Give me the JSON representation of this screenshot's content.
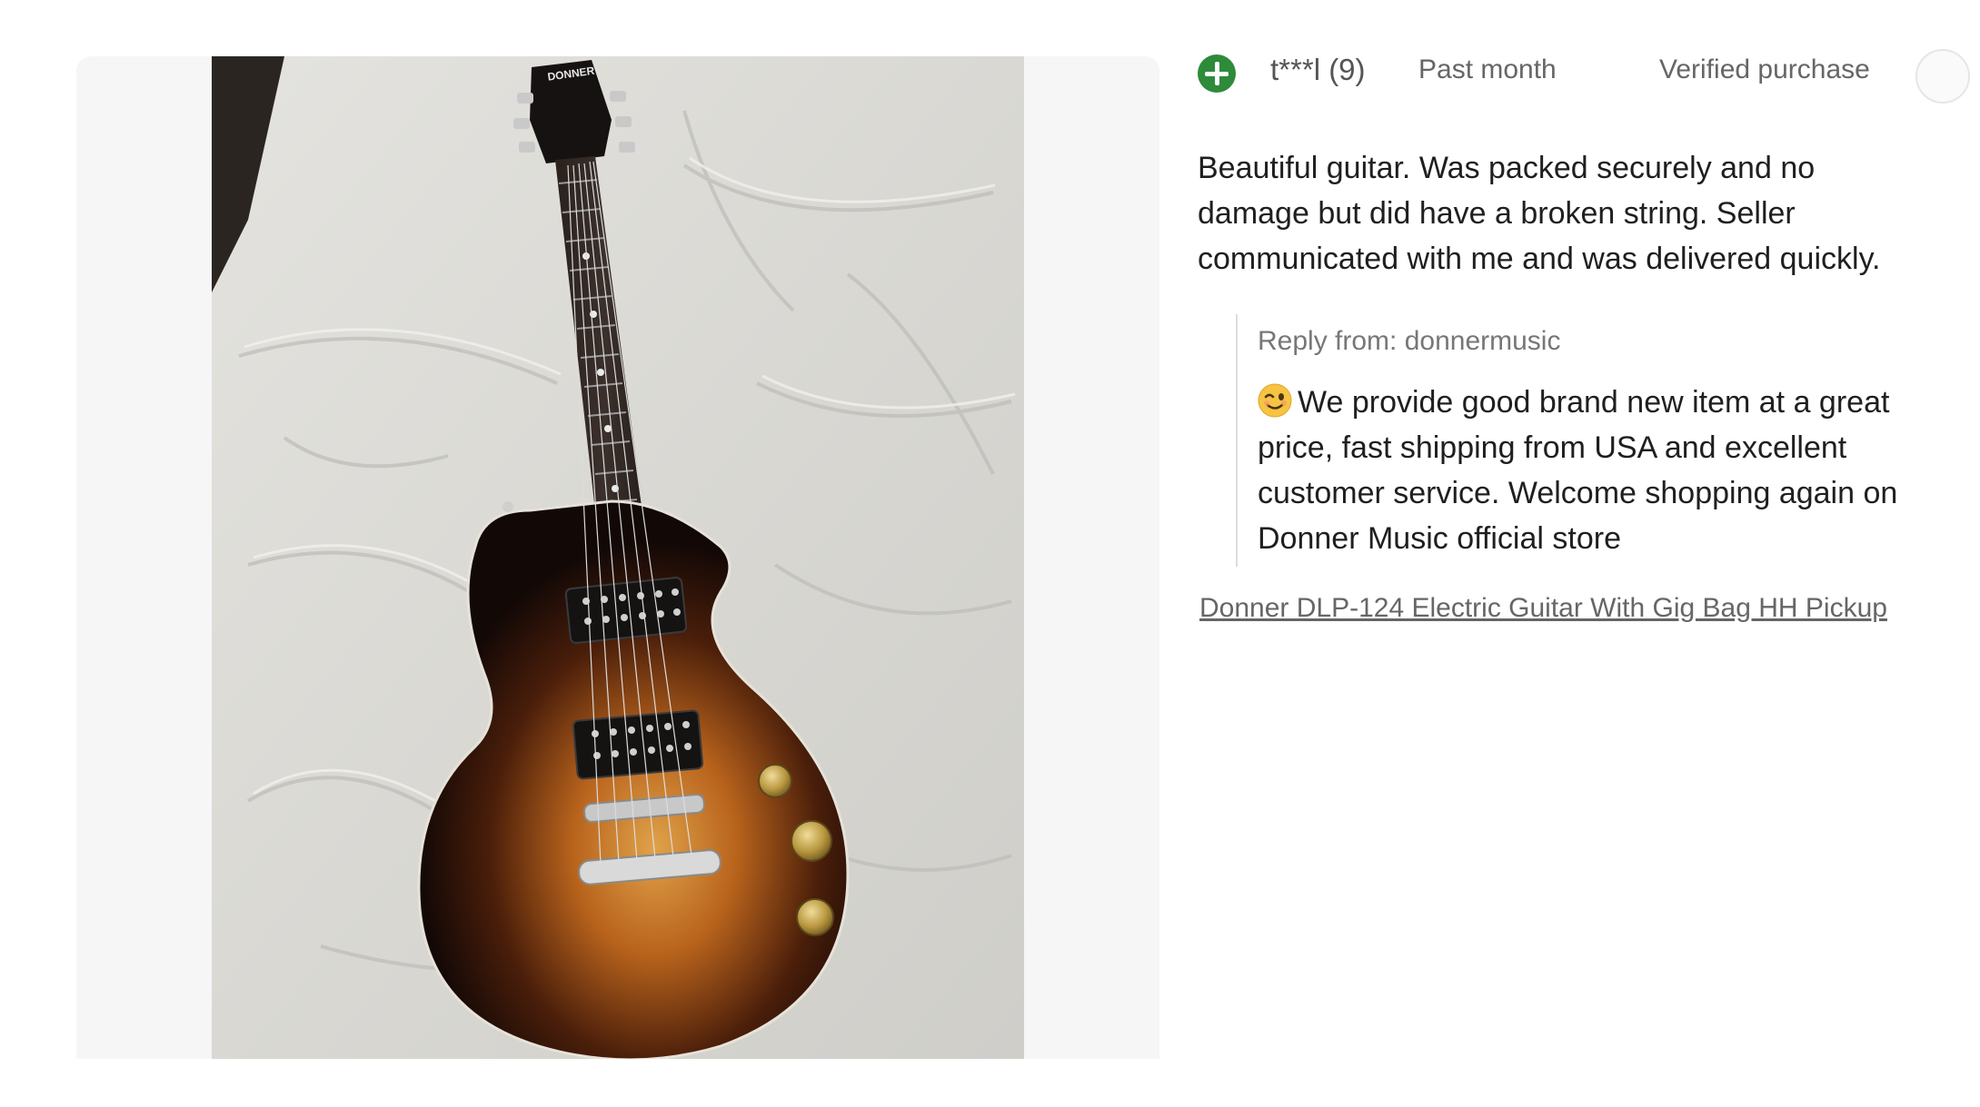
{
  "media": {
    "photo_icon": "guitar-photo",
    "brand_on_headstock": "DONNER"
  },
  "review": {
    "avatar_icon": "plus-icon",
    "avatar_color": "#2e8b3a",
    "reviewer": "t***l (9)",
    "date": "Past month",
    "verified": "Verified purchase",
    "body": "Beautiful guitar. Was packed securely and no damage but did have a broken string. Seller communicated with me and was delivered quickly.",
    "reply": {
      "from": "Reply from: donnermusic",
      "emoji_icon": "winking-face-icon",
      "text": "We provide good brand new item at a great price, fast shipping from USA and excellent customer service. Welcome shopping again on Donner Music official store"
    },
    "product_link": "Donner DLP-124 Electric Guitar With Gig Bag HH Pickup"
  }
}
